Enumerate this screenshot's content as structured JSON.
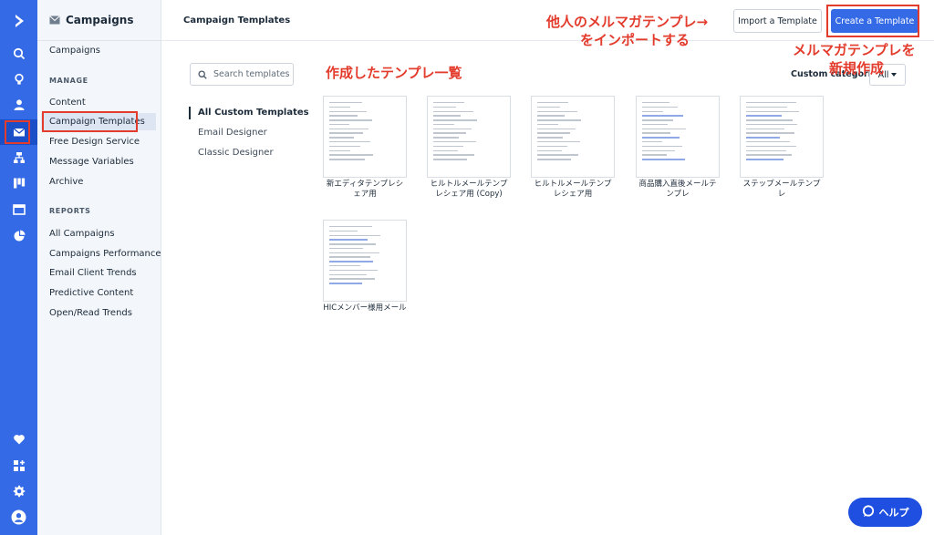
{
  "sidebar": {
    "section_title": "Campaigns",
    "top_item": "Campaigns",
    "manage_header": "MANAGE",
    "manage_items": [
      "Content",
      "Campaign Templates",
      "Free Design Service",
      "Message Variables",
      "Archive"
    ],
    "reports_header": "REPORTS",
    "reports_items": [
      "All Campaigns",
      "Campaigns Performance",
      "Email Client Trends",
      "Predictive Content",
      "Open/Read Trends"
    ]
  },
  "header": {
    "title": "Campaign Templates",
    "import_label": "Import a Template",
    "create_label": "Create a Template"
  },
  "search": {
    "placeholder": "Search templates"
  },
  "categories": {
    "items": [
      "All Custom Templates",
      "Email Designer",
      "Classic Designer"
    ],
    "selected": "All Custom Templates",
    "custom_label": "Custom categories",
    "custom_value": "All"
  },
  "templates": [
    {
      "name": "新エディタテンプレシェア用"
    },
    {
      "name": "ヒルトルメールテンプレシェア用 (Copy)"
    },
    {
      "name": "ヒルトルメールテンプレシェア用"
    },
    {
      "name": "商品購入直後メールテンプレ"
    },
    {
      "name": "ステップメールテンプレ"
    },
    {
      "name": "HICメンバー様用メール"
    }
  ],
  "annotations": {
    "import_note_line1": "他人のメルマガテンプレ→",
    "import_note_line2": "をインポートする",
    "create_note_line1": "メルマガテンプレを",
    "create_note_line2": "新規作成",
    "list_note": "作成したテンプレ一覧",
    "color": "#e33b2c"
  },
  "help_label": "ヘルプ",
  "colors": {
    "accent": "#356ae6",
    "rail": "#356ae6",
    "annotation": "#e33b2c"
  },
  "icons": [
    "logo-chevron-icon",
    "search-icon",
    "lightbulb-icon",
    "contacts-icon",
    "campaigns-envelope-icon",
    "automations-icon",
    "deals-board-icon",
    "site-icon",
    "reports-pie-icon",
    "heart-icon",
    "apps-icon",
    "gear-icon",
    "user-avatar-icon"
  ]
}
